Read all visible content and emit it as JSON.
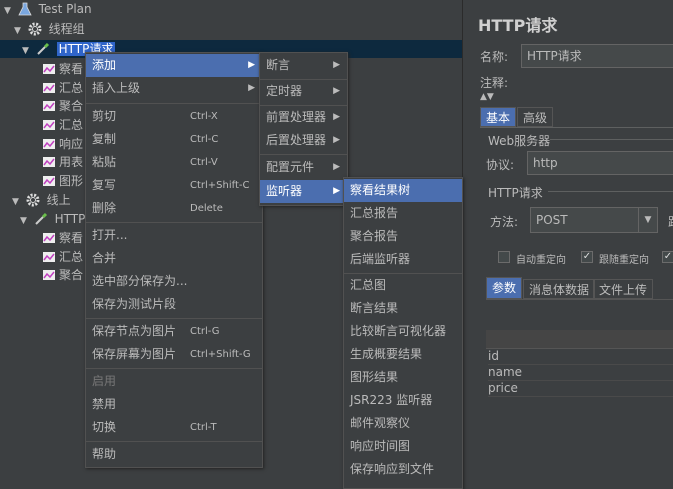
{
  "tree": {
    "items": [
      {
        "label": "Test Plan",
        "icon": "flask-icon"
      },
      {
        "label": "线程组",
        "icon": "gear-icon"
      },
      {
        "label": "HTTP请求",
        "icon": "pipette-icon"
      },
      {
        "label": "察看",
        "icon": "graph-icon"
      },
      {
        "label": "汇总",
        "icon": "graph-icon"
      },
      {
        "label": "聚合",
        "icon": "graph-icon"
      },
      {
        "label": "汇总",
        "icon": "graph-icon"
      },
      {
        "label": "响应",
        "icon": "graph-icon"
      },
      {
        "label": "用表",
        "icon": "graph-icon"
      },
      {
        "label": "图形",
        "icon": "graph-icon"
      },
      {
        "label": "线上",
        "icon": "gear-icon"
      },
      {
        "label": "HTTP",
        "icon": "pipette-icon"
      },
      {
        "label": "察看",
        "icon": "graph-icon"
      },
      {
        "label": "汇总",
        "icon": "graph-icon"
      },
      {
        "label": "聚合",
        "icon": "graph-icon"
      }
    ]
  },
  "context_menu": {
    "items": [
      {
        "label": "添加",
        "shortcut": "",
        "submenu": true
      },
      {
        "label": "插入上级",
        "shortcut": "",
        "submenu": true
      },
      {
        "label": "剪切",
        "shortcut": "Ctrl-X"
      },
      {
        "label": "复制",
        "shortcut": "Ctrl-C"
      },
      {
        "label": "粘贴",
        "shortcut": "Ctrl-V"
      },
      {
        "label": "复写",
        "shortcut": "Ctrl+Shift-C"
      },
      {
        "label": "删除",
        "shortcut": "Delete"
      },
      {
        "label": "打开...",
        "shortcut": ""
      },
      {
        "label": "合并",
        "shortcut": ""
      },
      {
        "label": "选中部分保存为...",
        "shortcut": ""
      },
      {
        "label": "保存为测试片段",
        "shortcut": ""
      },
      {
        "label": "保存节点为图片",
        "shortcut": "Ctrl-G"
      },
      {
        "label": "保存屏幕为图片",
        "shortcut": "Ctrl+Shift-G"
      },
      {
        "label": "启用",
        "shortcut": ""
      },
      {
        "label": "禁用",
        "shortcut": ""
      },
      {
        "label": "切换",
        "shortcut": "Ctrl-T"
      },
      {
        "label": "帮助",
        "shortcut": ""
      }
    ]
  },
  "add_submenu": {
    "items": [
      "断言",
      "定时器",
      "前置处理器",
      "后置处理器",
      "配置元件",
      "监听器"
    ]
  },
  "listener_submenu": {
    "items": [
      "察看结果树",
      "汇总报告",
      "聚合报告",
      "后端监听器",
      "汇总图",
      "断言结果",
      "比较断言可视化器",
      "生成概要结果",
      "图形结果",
      "JSR223 监听器",
      "邮件观察仪",
      "响应时间图",
      "保存响应到文件"
    ]
  },
  "panel": {
    "title": "HTTP请求",
    "name_label": "名称:",
    "name_value": "HTTP请求",
    "comment_label": "注释:",
    "tabs": [
      "基本",
      "高级"
    ],
    "web_server_label": "Web服务器",
    "protocol_label": "协议:",
    "protocol_value": "http",
    "http_request_label": "HTTP请求",
    "method_label": "方法:",
    "method_value": "POST",
    "path_label_fragment": "路",
    "checkboxes": [
      {
        "label": "自动重定向",
        "checked": false
      },
      {
        "label": "跟随重定向",
        "checked": true
      },
      {
        "label": "",
        "checked": true
      }
    ],
    "param_tabs": [
      "参数",
      "消息体数据",
      "文件上传"
    ],
    "params": [
      "id",
      "name",
      "price"
    ]
  },
  "colors": {
    "selection": "#4b6eaf",
    "background": "#3c3f41",
    "tree_selection": "#2f65ca"
  }
}
